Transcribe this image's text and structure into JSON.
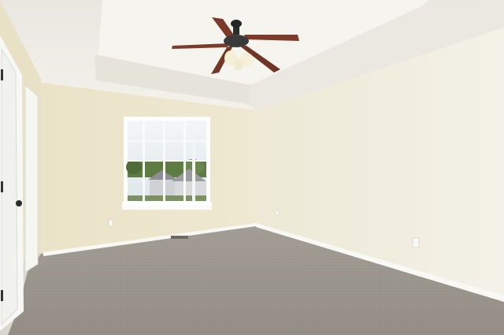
{
  "scene": {
    "description_shown": "",
    "colors": {
      "ceiling": "#f1efe8",
      "tray_ceiling": "#f5f3ed",
      "left_wall": "#ece6cf",
      "back_wall": "#efe8d2",
      "right_wall": "#f2efe2",
      "carpet": "#9d9890",
      "baseboard": "#f7f7f4",
      "door": "#f4f4f2",
      "window_frame": "#ffffff",
      "window_glass_sky": "#e9eef2",
      "window_trees": "#5c7a42",
      "fan_body": "#2b2b2b",
      "fan_blade": "#7a3a2a",
      "fan_light": "#f4eed7"
    },
    "icons": [
      "ceiling-fan-icon",
      "door-knob-icon",
      "outlet-icon",
      "floor-vent-icon"
    ]
  }
}
